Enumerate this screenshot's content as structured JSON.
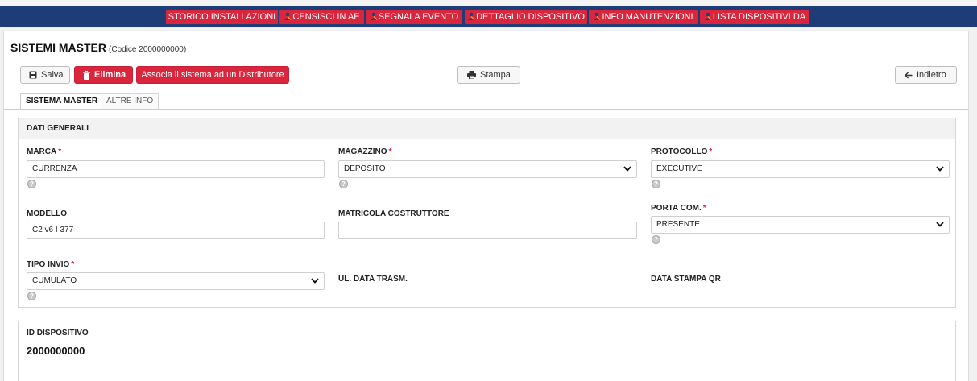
{
  "nav": [
    {
      "label": "STORICO INSTALLAZIONI",
      "icon": ""
    },
    {
      "label": "CENSISCI IN AE",
      "icon": "user-icon"
    },
    {
      "label": "SEGNALA EVENTO",
      "icon": "user-icon"
    },
    {
      "label": "DETTAGLIO DISPOSITIVO",
      "icon": "user-icon"
    },
    {
      "label": "INFO MANUTENZIONI",
      "icon": "user-icon"
    },
    {
      "label": "LISTA DISPOSITIVI DA",
      "icon": "user-icon"
    }
  ],
  "header": {
    "title": "SISTEMI MASTER",
    "subtitle": "(Codice 2000000000)"
  },
  "toolbar": {
    "save": "Salva",
    "delete": "Elimina",
    "assign": "Associa il sistema ad un Distributore",
    "print": "Stampa",
    "back": "Indietro"
  },
  "tabs": [
    "SISTEMA MASTER",
    "ALTRE INFO"
  ],
  "section": {
    "title": "DATI GENERALI",
    "fields": {
      "marca": {
        "label": "MARCA",
        "value": "CURRENZA",
        "required": "*"
      },
      "magazzino": {
        "label": "MAGAZZINO",
        "value": "DEPOSITO",
        "required": "*"
      },
      "protocollo": {
        "label": "PROTOCOLLO",
        "value": "EXECUTIVE",
        "required": "*"
      },
      "modello": {
        "label": "MODELLO",
        "value": "C2 v6 I 377"
      },
      "matricola": {
        "label": "MATRICOLA COSTRUTTORE",
        "value": ""
      },
      "porta": {
        "label": "PORTA COM.",
        "value": "PRESENTE",
        "required": "*"
      },
      "tipo_invio": {
        "label": "TIPO INVIO",
        "value": "CUMULATO",
        "required": "*"
      },
      "ul_data": {
        "label": "UL. DATA TRASM."
      },
      "data_qr": {
        "label": "DATA STAMPA QR"
      }
    },
    "help_glyph": "?"
  },
  "device": {
    "label": "ID DISPOSITIVO",
    "value": "2000000000"
  },
  "colors": {
    "navbar": "#1e3d78",
    "accent_red": "#d9263d"
  }
}
